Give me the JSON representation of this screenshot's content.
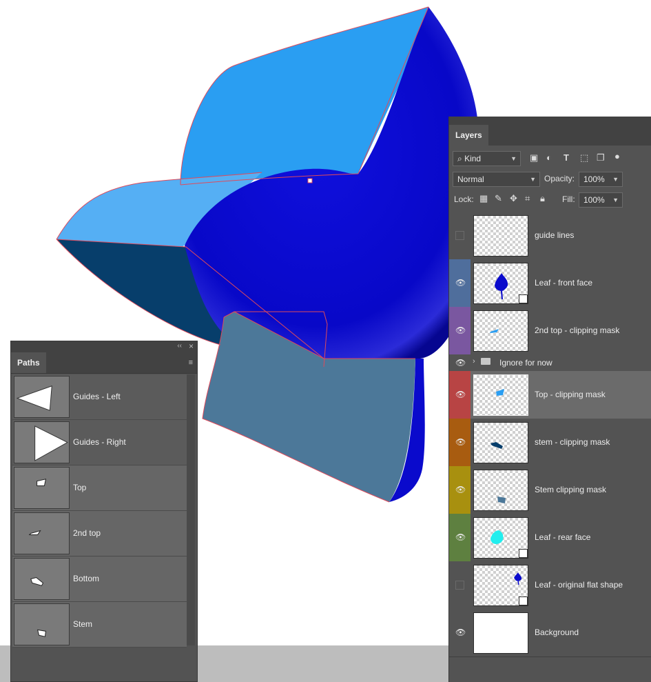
{
  "paths_panel": {
    "tab_label": "Paths",
    "items": [
      {
        "label": "Guides - Left",
        "thumb": "left-triangle"
      },
      {
        "label": "Guides - Right",
        "thumb": "right-triangle"
      },
      {
        "label": "Top",
        "thumb": "small-shape"
      },
      {
        "label": "2nd top",
        "thumb": "small-shape"
      },
      {
        "label": "Bottom",
        "thumb": "small-shape"
      },
      {
        "label": "Stem",
        "thumb": "small-shape"
      }
    ]
  },
  "layers_panel": {
    "tab_label": "Layers",
    "filter": {
      "label": "Kind"
    },
    "blend_mode": "Normal",
    "opacity_label": "Opacity:",
    "opacity_value": "100%",
    "lock_label": "Lock:",
    "fill_label": "Fill:",
    "fill_value": "100%",
    "layers": [
      {
        "name": "guide lines",
        "visible": false,
        "color": "#535353"
      },
      {
        "name": "Leaf - front face",
        "visible": true,
        "color": "#4f6e9c"
      },
      {
        "name": "2nd top - clipping mask",
        "visible": true,
        "color": "#7a57a0"
      },
      {
        "name": "Ignore for now",
        "visible": true,
        "color": "#535353",
        "type": "group"
      },
      {
        "name": "Top - clipping mask",
        "visible": true,
        "color": "#b84444",
        "selected": true
      },
      {
        "name": "stem - clipping mask",
        "visible": true,
        "color": "#a85c10"
      },
      {
        "name": "Stem clipping mask",
        "visible": true,
        "color": "#a8900f"
      },
      {
        "name": "Leaf - rear face",
        "visible": true,
        "color": "#5e8040"
      },
      {
        "name": "Leaf - original flat shape",
        "visible": false,
        "color": "#535353"
      },
      {
        "name": "Background",
        "visible": true,
        "color": "#535353"
      }
    ]
  },
  "colors": {
    "leaf_blue": "#0a0acc",
    "light_face": "#2a9ef2",
    "lighter_face": "#55aff4",
    "dark_face": "#073e6b",
    "stem_face": "#4c7899",
    "guide_red": "#e04a5a"
  }
}
